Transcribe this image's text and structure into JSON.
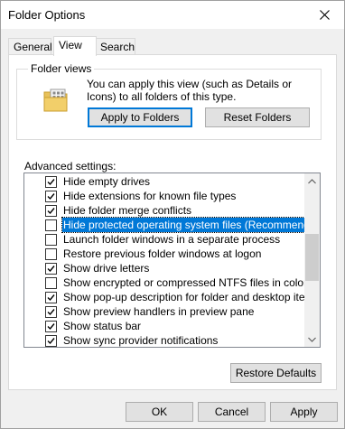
{
  "window": {
    "title": "Folder Options",
    "close_icon": "close-icon"
  },
  "tabs": [
    {
      "label": "General"
    },
    {
      "label": "View"
    },
    {
      "label": "Search"
    }
  ],
  "folder_views": {
    "label": "Folder views",
    "description": "You can apply this view (such as Details or Icons) to all folders of this type.",
    "apply_button": "Apply to Folders",
    "reset_button": "Reset Folders",
    "icon": "folder-view-icon"
  },
  "advanced": {
    "label": "Advanced settings:",
    "items": [
      {
        "label": "Hide empty drives",
        "checked": true
      },
      {
        "label": "Hide extensions for known file types",
        "checked": true
      },
      {
        "label": "Hide folder merge conflicts",
        "checked": true
      },
      {
        "label": "Hide protected operating system files (Recommended)",
        "checked": false,
        "selected": true
      },
      {
        "label": "Launch folder windows in a separate process",
        "checked": false
      },
      {
        "label": "Restore previous folder windows at logon",
        "checked": false
      },
      {
        "label": "Show drive letters",
        "checked": true
      },
      {
        "label": "Show encrypted or compressed NTFS files in color",
        "checked": false
      },
      {
        "label": "Show pop-up description for folder and desktop items",
        "checked": true
      },
      {
        "label": "Show preview handlers in preview pane",
        "checked": true
      },
      {
        "label": "Show status bar",
        "checked": true
      },
      {
        "label": "Show sync provider notifications",
        "checked": true
      }
    ],
    "restore_button": "Restore Defaults"
  },
  "footer": {
    "ok": "OK",
    "cancel": "Cancel",
    "apply": "Apply"
  },
  "colors": {
    "accent": "#0078d7",
    "window_bg": "#f0f0f0",
    "border": "#adadad"
  }
}
